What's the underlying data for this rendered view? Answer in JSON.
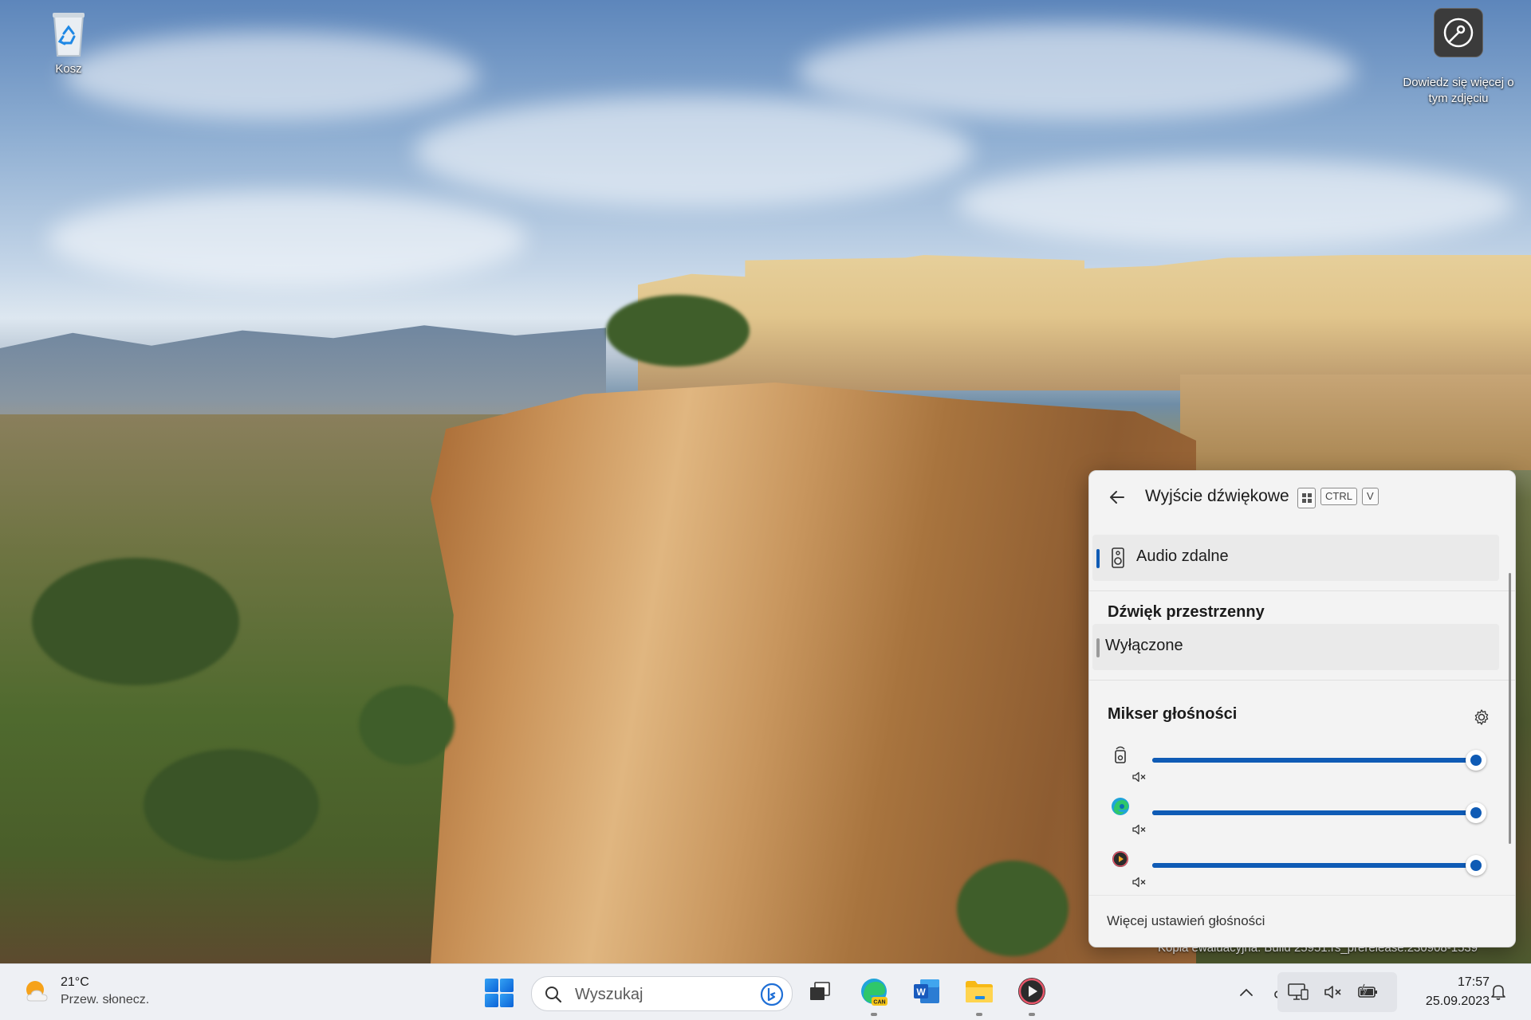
{
  "desktop": {
    "recycle_bin_label": "Kosz",
    "learn_more_label_line1": "Dowiedz się więcej o",
    "learn_more_label_line2": "tym zdjęciu",
    "watermark": "Kopia ewaluacyjna. Build 25951.rs_prerelease.230908-1539"
  },
  "flyout": {
    "title": "Wyjście dźwiękowe",
    "shortcut_keys": [
      "CTRL",
      "V"
    ],
    "output_device": "Audio zdalne",
    "spatial_title": "Dźwięk przestrzenny",
    "spatial_value": "Wyłączone",
    "mixer_title": "Mikser głośności",
    "mixer_apps": [
      {
        "icon": "system-sounds-icon",
        "volume": 100,
        "muted": true
      },
      {
        "icon": "edge-icon",
        "volume": 100,
        "muted": true
      },
      {
        "icon": "media-player-icon",
        "volume": 100,
        "muted": true
      }
    ],
    "more_settings": "Więcej ustawień głośności"
  },
  "taskbar": {
    "temperature": "21°C",
    "weather": "Przew. słonecz.",
    "search_placeholder": "Wyszukaj",
    "time": "17:57",
    "date": "25.09.2023"
  },
  "colors": {
    "accent": "#0f5bb5",
    "selection_indicator": "#0f5bb5",
    "spatial_indicator": "#9a9a9a",
    "slider_track": "#0f5bb5"
  }
}
